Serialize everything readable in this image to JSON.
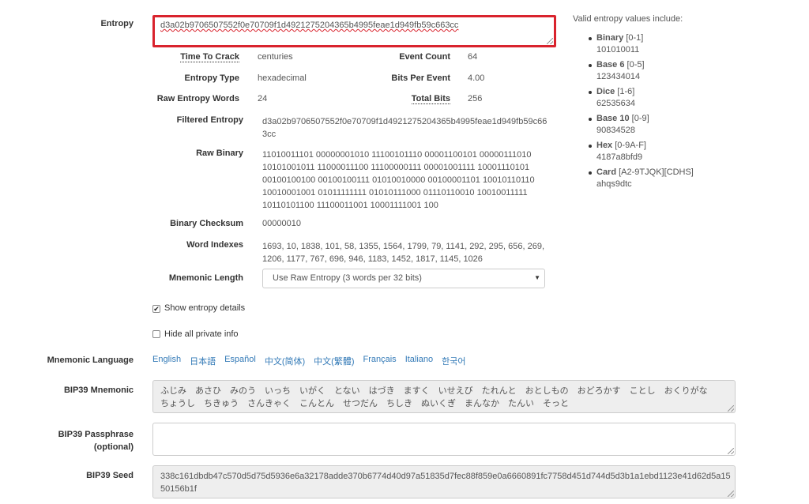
{
  "entropy": {
    "label": "Entropy",
    "value": "d3a02b9706507552f0e70709f1d4921275204365b4995feae1d949fb59c663cc"
  },
  "details": {
    "time_to_crack_label": "Time To Crack",
    "time_to_crack": "centuries",
    "event_count_label": "Event Count",
    "event_count": "64",
    "entropy_type_label": "Entropy Type",
    "entropy_type": "hexadecimal",
    "bits_per_event_label": "Bits Per Event",
    "bits_per_event": "4.00",
    "raw_entropy_words_label": "Raw Entropy Words",
    "raw_entropy_words": "24",
    "total_bits_label": "Total Bits",
    "total_bits": "256",
    "filtered_entropy_label": "Filtered Entropy",
    "filtered_entropy_line1": "d3a02b9706507552f0e70709f1d4921275204365b4995feae1d949fb59c66",
    "filtered_entropy_line2": "3cc",
    "raw_binary_label": "Raw Binary",
    "raw_binary_lines": [
      "11010011101 00000001010 11100101110 00001100101 00000111010",
      "10101001011 11000011100 11100000111 00001001111 10001110101",
      "00100100100 00100100111 01010010000 00100001101 10010110110",
      "10010001001 01011111111 01010111000 01110110010 10010011111",
      "10110101100 11100011001 10001111001 100"
    ],
    "binary_checksum_label": "Binary Checksum",
    "binary_checksum": "00000010",
    "word_indexes_label": "Word Indexes",
    "word_indexes_line1": "1693, 10, 1838, 101, 58, 1355, 1564, 1799, 79, 1141, 292, 295, 656, 269,",
    "word_indexes_line2": "1206, 1177, 767, 696, 946, 1183, 1452, 1817, 1145, 1026",
    "mnemonic_length_label": "Mnemonic Length",
    "mnemonic_length_selected": "Use Raw Entropy (3 words per 32 bits)"
  },
  "valid_entropy": {
    "heading": "Valid entropy values include:",
    "items": [
      {
        "name": "Binary",
        "range": "[0-1]",
        "example": "101010011"
      },
      {
        "name": "Base 6",
        "range": "[0-5]",
        "example": "123434014"
      },
      {
        "name": "Dice",
        "range": "[1-6]",
        "example": "62535634"
      },
      {
        "name": "Base 10",
        "range": "[0-9]",
        "example": "90834528"
      },
      {
        "name": "Hex",
        "range": "[0-9A-F]",
        "example": "4187a8bfd9"
      },
      {
        "name": "Card",
        "range": "[A2-9TJQK][CDHS]",
        "example": "ahqs9dtc"
      }
    ]
  },
  "options": {
    "show_entropy_details": "Show entropy details",
    "show_entropy_details_checked": true,
    "hide_private_info": "Hide all private info",
    "hide_private_info_checked": false
  },
  "language": {
    "label": "Mnemonic Language",
    "items": [
      "English",
      "日本語",
      "Español",
      "中文(简体)",
      "中文(繁體)",
      "Français",
      "Italiano",
      "한국어"
    ]
  },
  "bip39": {
    "mnemonic_label": "BIP39 Mnemonic",
    "mnemonic_line1": "ふじみ　あさひ　みのう　いっち　いがく　とない　はづき　ますく　いせえび　たれんと　おとしもの　おどろかす　ことし　おくりがな",
    "mnemonic_line2": "ちょうし　ちきゅう　さんきゃく　こんとん　せつだん　ちしき　ぬいくぎ　まんなか　たんい　そっと",
    "passphrase_label_1": "BIP39 Passphrase",
    "passphrase_label_2": "(optional)",
    "passphrase_value": "",
    "seed_label": "BIP39 Seed",
    "seed_line1": "338c161dbdb47c570d5d75d5936e6a32178adde370b6774d40d97a51835d7fec88f859e0a6660891fc7758d451d744d5d3b1a1ebd1123e41d62d5a15",
    "seed_line2": "50156b1f"
  }
}
